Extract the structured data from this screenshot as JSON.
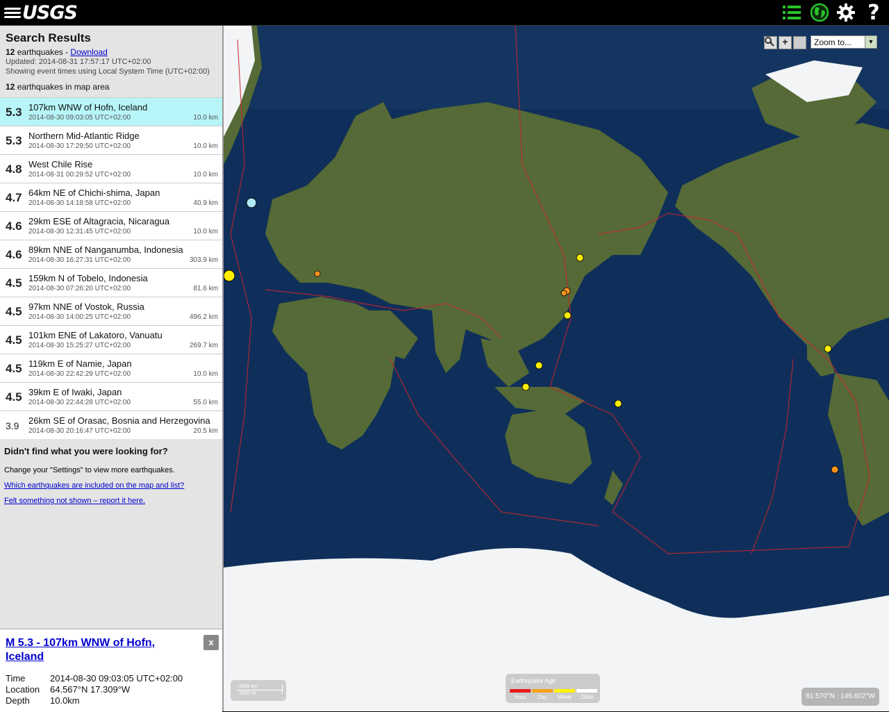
{
  "header": {
    "logo_text": "USGS",
    "icons": [
      "list-icon",
      "globe-icon",
      "gear-icon",
      "help-icon"
    ]
  },
  "results": {
    "title": "Search Results",
    "count": "12",
    "count_suffix": " earthquakes - ",
    "download_label": "Download",
    "updated": "Updated: 2014-08-31 17:57:17 UTC+02:00",
    "time_note": "Showing event times using Local System Time (UTC+02:00)",
    "map_count": "12",
    "map_count_suffix": " earthquakes in map area"
  },
  "earthquakes": [
    {
      "mag": "5.3",
      "place": "107km WNW of Hofn, Iceland",
      "time": "2014-08-30 09:03:05 UTC+02:00",
      "depth": "10.0 km",
      "selected": true
    },
    {
      "mag": "5.3",
      "place": "Northern Mid-Atlantic Ridge",
      "time": "2014-08-30 17:29:50 UTC+02:00",
      "depth": "10.0 km"
    },
    {
      "mag": "4.8",
      "place": "West Chile Rise",
      "time": "2014-08-31 00:29:52 UTC+02:00",
      "depth": "10.0 km"
    },
    {
      "mag": "4.7",
      "place": "64km NE of Chichi-shima, Japan",
      "time": "2014-08-30 14:18:58 UTC+02:00",
      "depth": "40.9 km"
    },
    {
      "mag": "4.6",
      "place": "29km ESE of Altagracia, Nicaragua",
      "time": "2014-08-30 12:31:45 UTC+02:00",
      "depth": "10.0 km"
    },
    {
      "mag": "4.6",
      "place": "89km NNE of Nanganumba, Indonesia",
      "time": "2014-08-30 16:27:31 UTC+02:00",
      "depth": "303.9 km"
    },
    {
      "mag": "4.5",
      "place": "159km N of Tobelo, Indonesia",
      "time": "2014-08-30 07:26:20 UTC+02:00",
      "depth": "81.6 km"
    },
    {
      "mag": "4.5",
      "place": "97km NNE of Vostok, Russia",
      "time": "2014-08-30 14:00:25 UTC+02:00",
      "depth": "496.2 km"
    },
    {
      "mag": "4.5",
      "place": "101km ENE of Lakatoro, Vanuatu",
      "time": "2014-08-30 15:25:27 UTC+02:00",
      "depth": "269.7 km"
    },
    {
      "mag": "4.5",
      "place": "119km E of Namie, Japan",
      "time": "2014-08-30 22:42:29 UTC+02:00",
      "depth": "10.0 km"
    },
    {
      "mag": "4.5",
      "place": "39km E of Iwaki, Japan",
      "time": "2014-08-30 22:44:28 UTC+02:00",
      "depth": "55.0 km"
    },
    {
      "mag": "3.9",
      "place": "26km SE of Orasac, Bosnia and Herzegovina",
      "time": "2014-08-30 20:16:47 UTC+02:00",
      "depth": "20.5 km"
    }
  ],
  "help": {
    "title": "Didn't find what you were looking for?",
    "settings_text": "Change your \"Settings\" to view more earthquakes.",
    "link1": "Which earthquakes are included on the map and list?",
    "link2": "Felt something not shown – report it here."
  },
  "detail": {
    "title": "M 5.3 - 107km WNW of Hofn, Iceland",
    "close_label": "x",
    "time_label": "Time",
    "time_value": "2014-08-30 09:03:05 UTC+02:00",
    "location_label": "Location",
    "location_value": "64.567°N 17.309°W",
    "depth_label": "Depth",
    "depth_value": "10.0km"
  },
  "map": {
    "zoom_out_label": "-",
    "zoom_in_label": "+",
    "zoom_select_value": "Zoom to...",
    "scale_km": "3000 km",
    "scale_mi": "2000 mi",
    "legend_title": "Earthquake Age",
    "legend": [
      {
        "label": "Hour",
        "color": "#e8191b"
      },
      {
        "label": "Day",
        "color": "#f6a11a"
      },
      {
        "label": "Week",
        "color": "#fff200"
      },
      {
        "label": "Older",
        "color": "#ffffff"
      }
    ],
    "coordinates": "81.570°N : 146.602°W",
    "colors": {
      "ocean": "#0f2f5a",
      "land": "#556a36",
      "ice": "#f2f4f6",
      "plate_boundary": "#c8252e",
      "marker_week": "#ffee00",
      "marker_day": "#f6931e",
      "marker_selected": "#aee9f5"
    }
  }
}
